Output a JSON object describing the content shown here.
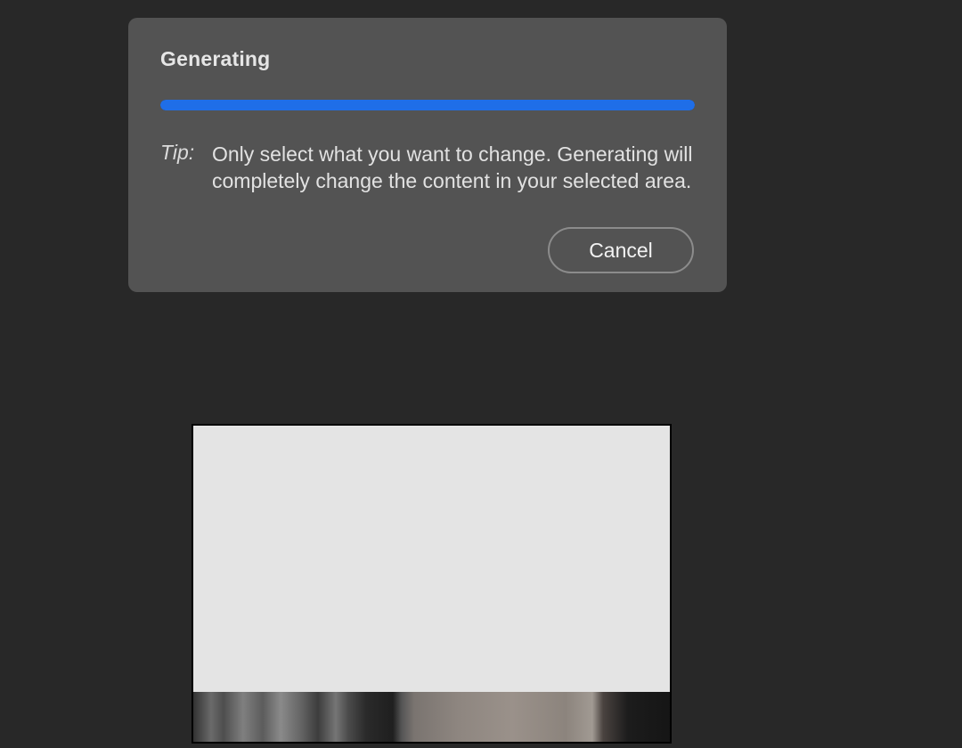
{
  "dialog": {
    "title": "Generating",
    "progress": 1.0,
    "accent_color": "#1f6ee8",
    "tip_label": "Tip:",
    "tip_text": "Only select what you want to change. Generating will completely change the content in your selected area.",
    "cancel_label": "Cancel"
  },
  "canvas": {
    "selection_fill_color": "#e4e4e4"
  }
}
